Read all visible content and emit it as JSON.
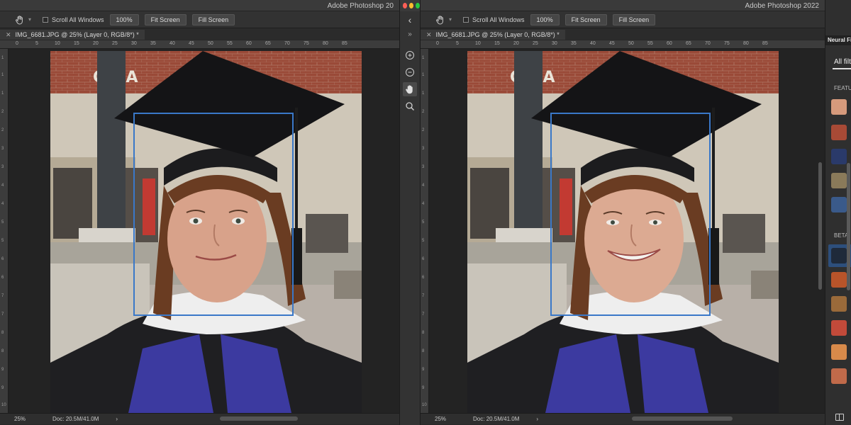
{
  "left_window": {
    "title": "Adobe Photoshop 20",
    "options": {
      "scroll_all_windows": "Scroll All Windows",
      "zoom_100": "100%",
      "fit_screen": "Fit Screen",
      "fill_screen": "Fill Screen"
    },
    "tab_label": "IMG_6681.JPG @ 25% (Layer 0, RGB/8*) *",
    "ruler_ticks": [
      "0",
      "5",
      "10",
      "15",
      "20",
      "25",
      "30",
      "35",
      "40",
      "45",
      "50",
      "55",
      "60",
      "65",
      "70",
      "75",
      "80",
      "85"
    ],
    "vruler_ticks": [
      "1",
      "1",
      "1",
      "2",
      "2",
      "3",
      "3",
      "4",
      "4",
      "5",
      "5",
      "6",
      "6",
      "7",
      "7",
      "8",
      "8",
      "9",
      "9",
      "10"
    ],
    "status_zoom": "25%",
    "status_doc": "Doc: 20.5M/41.0M",
    "status_arrow": "›"
  },
  "right_window": {
    "title": "Adobe Photoshop 2022",
    "options": {
      "scroll_all_windows": "Scroll All Windows",
      "zoom_100": "100%",
      "fit_screen": "Fit Screen",
      "fill_screen": "Fill Screen"
    },
    "tab_label": "IMG_6681.JPG @ 25% (Layer 0, RGB/8*) *",
    "ruler_ticks": [
      "0",
      "5",
      "10",
      "15",
      "20",
      "25",
      "30",
      "35",
      "40",
      "45",
      "50",
      "55",
      "60",
      "65",
      "70",
      "75",
      "80",
      "85"
    ],
    "vruler_ticks": [
      "1",
      "1",
      "1",
      "2",
      "2",
      "3",
      "3",
      "4",
      "4",
      "5",
      "5",
      "6",
      "6",
      "7",
      "7",
      "8",
      "8",
      "9",
      "9",
      "10"
    ],
    "status_zoom": "25%",
    "status_doc": "Doc: 20.5M/41.0M",
    "status_arrow": "›"
  },
  "middle_toolbar": {
    "collapse_arrow": "»",
    "back_glyph": "‹"
  },
  "neural_panel": {
    "title": "Neural Fi",
    "all_filters": "All filt",
    "featured": "FEATU",
    "beta": "BETA"
  },
  "colors": {
    "face_box": "#3a78c8",
    "accent": "#3d6dab"
  }
}
